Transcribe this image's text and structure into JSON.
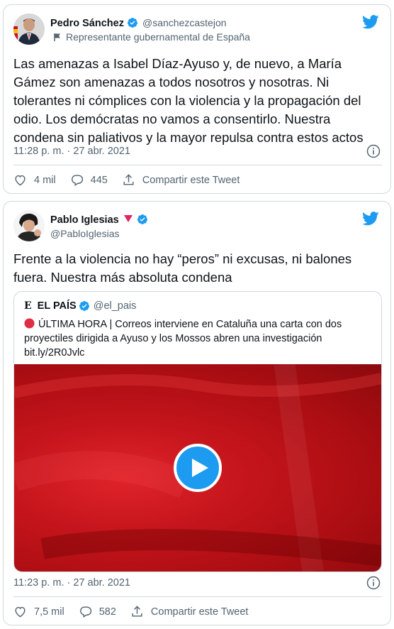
{
  "tweets": [
    {
      "name": "Pedro Sánchez",
      "handle": "@sanchezcastejon",
      "label_text": "Representante gubernamental de España",
      "text_lines": [
        "Las amenazas a Isabel Díaz-Ayuso y, de nuevo, a María",
        "Gámez son amenazas a todos nosotros y nosotras. Ni",
        "tolerantes ni cómplices con la violencia y la propagación del",
        "odio. Los demócratas no vamos a consentirlo. Nuestra",
        "condena sin paliativos y la mayor repulsa contra estos actos"
      ],
      "timestamp": "11:28 p. m. · 27 abr. 2021",
      "likes": "4 mil",
      "replies": "445",
      "share_label": "Compartir este Tweet"
    },
    {
      "name": "Pablo Iglesias",
      "handle": "@PabloIglesias",
      "text_lines": [
        "Frente a la violencia no hay “peros” ni excusas, ni balones",
        "fuera. Nuestra más absoluta condena"
      ],
      "quote": {
        "logo": "E",
        "name": "EL PAÍS",
        "handle": "@el_pais",
        "text_lines": [
          "ÚLTIMA HORA | Correos interviene en Cataluña una carta con dos",
          "proyectiles dirigida a Ayuso y los Mossos abren una investigación",
          "bit.ly/2R0Jvlc"
        ]
      },
      "timestamp": "11:23 p. m. · 27 abr. 2021",
      "likes": "7,5 mil",
      "replies": "582",
      "share_label": "Compartir este Tweet"
    }
  ],
  "colors": {
    "accent": "#1d9bf0",
    "text_secondary": "#536471",
    "border": "#cfd9de",
    "breaking_red": "#e0245e"
  },
  "icons": [
    "verified-badge-icon",
    "twitter-bird-icon",
    "flag-icon",
    "info-icon",
    "heart-icon",
    "reply-icon",
    "share-icon",
    "play-icon",
    "red-circle-icon",
    "heart-emoji-icon"
  ]
}
